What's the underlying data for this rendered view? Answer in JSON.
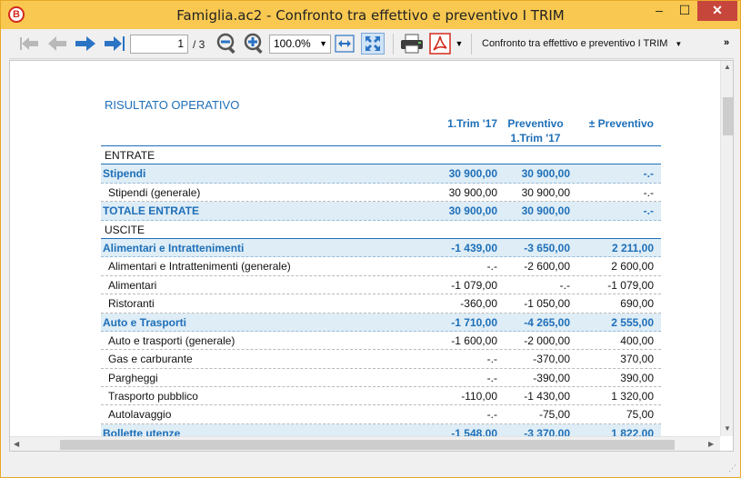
{
  "window": {
    "title": "Famiglia.ac2 - Confronto tra effettivo e preventivo I TRIM",
    "minimize": "–",
    "maximize": "☐",
    "close": "✕"
  },
  "toolbar": {
    "page_current": "1",
    "page_total": "/ 3",
    "zoom": "100.0%",
    "report": "Confronto tra effettivo e preventivo I TRIM",
    "more": "»"
  },
  "report": {
    "title": "RISULTATO OPERATIVO",
    "columns": [
      "1.Trim '17",
      "Preventivo\n1.Trim '17",
      "± Preventivo"
    ],
    "rows": [
      {
        "type": "head",
        "label": "ENTRATE",
        "v1": "",
        "v2": "",
        "v3": ""
      },
      {
        "type": "cat",
        "label": "Stipendi",
        "v1": "30 900,00",
        "v2": "30 900,00",
        "v3": "-.-"
      },
      {
        "type": "item",
        "label": "Stipendi (generale)",
        "v1": "30 900,00",
        "v2": "30 900,00",
        "v3": "-.-"
      },
      {
        "type": "cat",
        "label": "TOTALE ENTRATE",
        "v1": "30 900,00",
        "v2": "30 900,00",
        "v3": "-.-"
      },
      {
        "type": "head",
        "label": "USCITE",
        "v1": "",
        "v2": "",
        "v3": ""
      },
      {
        "type": "cat",
        "label": "Alimentari e Intrattenimenti",
        "v1": "-1 439,00",
        "v2": "-3 650,00",
        "v3": "2 211,00"
      },
      {
        "type": "item",
        "label": "Alimentari e Intrattenimenti (generale)",
        "v1": "-.-",
        "v2": "-2 600,00",
        "v3": "2 600,00"
      },
      {
        "type": "item",
        "label": "Alimentari",
        "v1": "-1 079,00",
        "v2": "-.-",
        "v3": "-1 079,00"
      },
      {
        "type": "item",
        "label": "Ristoranti",
        "v1": "-360,00",
        "v2": "-1 050,00",
        "v3": "690,00"
      },
      {
        "type": "cat",
        "label": "Auto e Trasporti",
        "v1": "-1 710,00",
        "v2": "-4 265,00",
        "v3": "2 555,00"
      },
      {
        "type": "item",
        "label": "Auto e trasporti (generale)",
        "v1": "-1 600,00",
        "v2": "-2 000,00",
        "v3": "400,00"
      },
      {
        "type": "item",
        "label": "Gas e carburante",
        "v1": "-.-",
        "v2": "-370,00",
        "v3": "370,00"
      },
      {
        "type": "item",
        "label": "Pargheggi",
        "v1": "-.-",
        "v2": "-390,00",
        "v3": "390,00"
      },
      {
        "type": "item",
        "label": "Trasporto pubblico",
        "v1": "-110,00",
        "v2": "-1 430,00",
        "v3": "1 320,00"
      },
      {
        "type": "item",
        "label": "Autolavaggio",
        "v1": "-.-",
        "v2": "-75,00",
        "v3": "75,00"
      },
      {
        "type": "cat",
        "label": "Bollette utenze",
        "v1": "-1 548,00",
        "v2": "-3 370,00",
        "v3": "1 822,00"
      }
    ]
  },
  "colors": {
    "accent": "#1e6fb8",
    "titlebar": "#f9c850",
    "category_row": "#deedf6",
    "pdf_red": "#d42a1e"
  }
}
